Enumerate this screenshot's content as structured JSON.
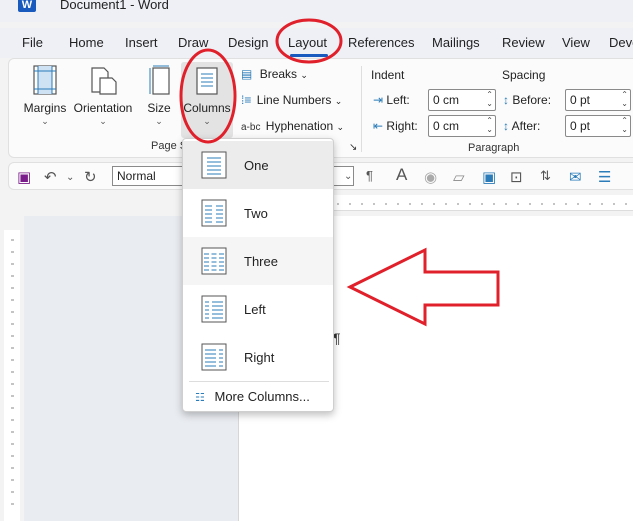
{
  "title": {
    "text": "Document1  -  Word"
  },
  "tabs": [
    "File",
    "Home",
    "Insert",
    "Draw",
    "Design",
    "Layout",
    "References",
    "Mailings",
    "Review",
    "View",
    "Deve"
  ],
  "ribbon": {
    "margins": "Margins",
    "orientation": "Orientation",
    "size": "Size",
    "columns": "Columns",
    "breaks": "Breaks",
    "line_numbers": "Line Numbers",
    "hyphenation": "Hyphenation",
    "page_setup_group": "Page S",
    "indent_header": "Indent",
    "spacing_header": "Spacing",
    "left_label": "Left:",
    "right_label": "Right:",
    "before_label": "Before:",
    "after_label": "After:",
    "left_value": "0 cm",
    "right_value": "0 cm",
    "before_value": "0 pt",
    "after_value": "0 pt",
    "paragraph_group": "Paragraph"
  },
  "qat": {
    "style_value": "Normal"
  },
  "columns_menu": {
    "items": [
      "One",
      "Two",
      "Three",
      "Left",
      "Right"
    ],
    "selected": "One",
    "hovered": "Three",
    "more": "More Columns..."
  },
  "document": {
    "pilcrow": "¶"
  },
  "colors": {
    "accent": "#185abd",
    "annotation": "#e0202a",
    "icon": "#2b7cb8"
  }
}
